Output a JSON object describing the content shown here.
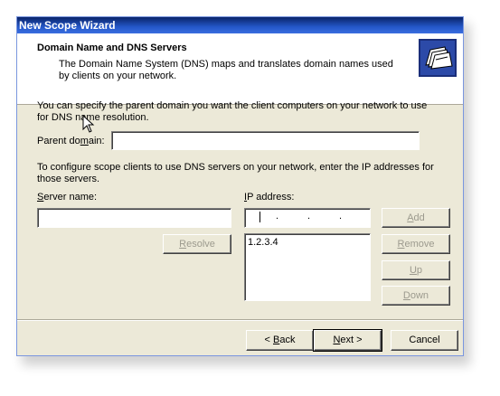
{
  "window": {
    "title": "New Scope Wizard"
  },
  "header": {
    "title": "Domain Name and DNS Servers",
    "description": "The Domain Name System (DNS) maps and translates domain names used by clients on your network.",
    "icon": "folders-wizard-icon"
  },
  "body": {
    "intro_text": "You can specify the parent domain you want the client computers on your network to use for DNS name resolution.",
    "parent_domain": {
      "label_pre": "Parent do",
      "label_u": "m",
      "label_post": "ain:",
      "value": ""
    },
    "dns_text": "To configure scope clients to use DNS servers on your network, enter the IP addresses for those servers.",
    "server_name": {
      "label_u": "S",
      "label_post": "erver name:",
      "value": ""
    },
    "ip_address": {
      "label_u": "I",
      "label_post": "P address:",
      "value": ""
    },
    "ip_list": [
      "1.2.3.4"
    ],
    "buttons": {
      "resolve": {
        "label_u": "R",
        "label_post": "esolve"
      },
      "add": {
        "label_u": "A",
        "label_post": "dd"
      },
      "remove": {
        "label_u": "R",
        "label_post": "emove"
      },
      "up": {
        "label_u": "U",
        "label_post": "p"
      },
      "down": {
        "label_u": "D",
        "label_post": "own"
      }
    }
  },
  "footer": {
    "back": {
      "pre": "< ",
      "u": "B",
      "post": "ack"
    },
    "next": {
      "u": "N",
      "post": "ext >"
    },
    "cancel": "Cancel"
  }
}
